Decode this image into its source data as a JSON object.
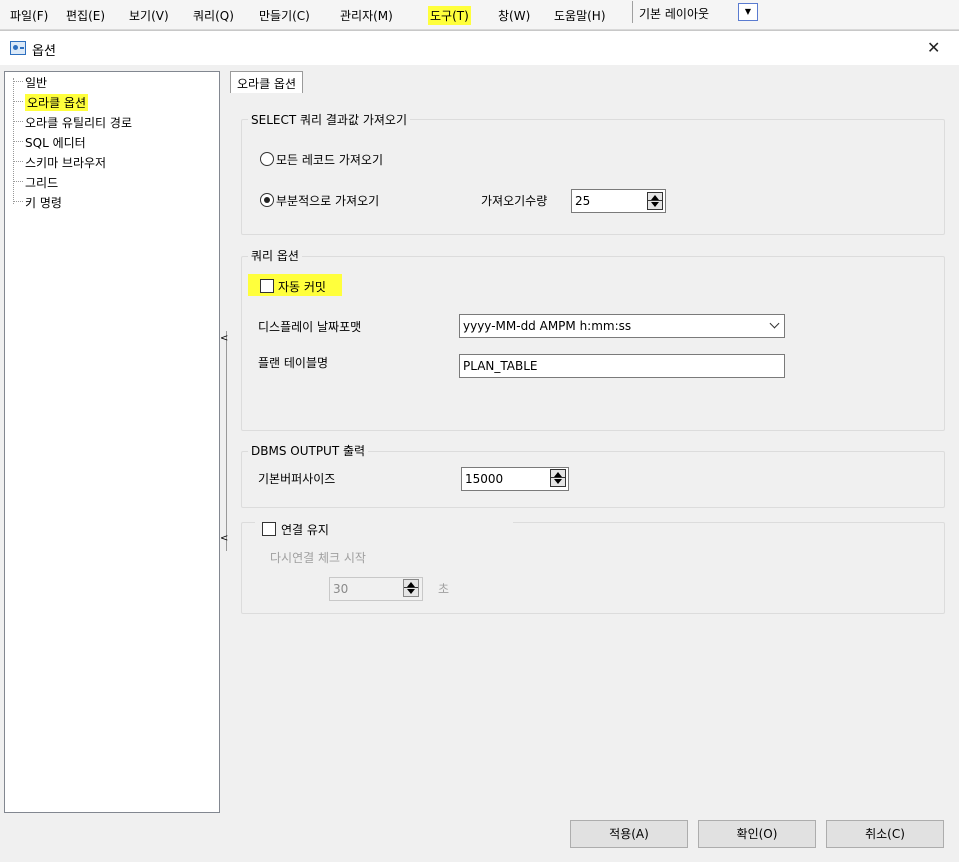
{
  "menubar": {
    "items": [
      "파일(F)",
      "편집(E)",
      "보기(V)",
      "쿼리(Q)",
      "만들기(C)",
      "관리자(M)",
      "도구(T)",
      "창(W)",
      "도움말(H)"
    ],
    "layout_label": "기본 레이아웃",
    "highlight_color": "#ffff3c"
  },
  "dialog": {
    "title": "옵션",
    "close": "✕",
    "tree": [
      "일반",
      "오라클 옵션",
      "오라클 유틸리티 경로",
      "SQL 에디터",
      "스키마 브라우저",
      "그리드",
      "키 명령"
    ],
    "selected_tree_item": "오라클 옵션",
    "tab": "오라클 옵션",
    "splitter_arrow": "<"
  },
  "select_group": {
    "title": "SELECT 쿼리 결과값 가져오기",
    "radio_all": "모든 레코드 가져오기",
    "radio_partial": "부분적으로 가져오기",
    "selected": "부분적으로 가져오기",
    "fetch_label": "가져오기수량",
    "fetch_value": "25"
  },
  "query_group": {
    "title": "쿼리 옵션",
    "autocommit_label": "자동 커밋",
    "autocommit_checked": false,
    "date_format_label": "디스플레이 날짜포맷",
    "date_format_value": "yyyy-MM-dd AMPM h:mm:ss",
    "plan_table_label": "플랜 테이블명",
    "plan_table_value": "PLAN_TABLE"
  },
  "dbms_group": {
    "title": "DBMS OUTPUT 출력",
    "buffer_label": "기본버퍼사이즈",
    "buffer_value": "15000"
  },
  "keepalive_group": {
    "checkbox_label": "연결 유지",
    "checked": false,
    "recheck_label": "다시연결 체크 시작",
    "interval_value": "30",
    "unit": "초"
  },
  "buttons": {
    "apply": "적용(A)",
    "ok": "확인(O)",
    "cancel": "취소(C)"
  }
}
